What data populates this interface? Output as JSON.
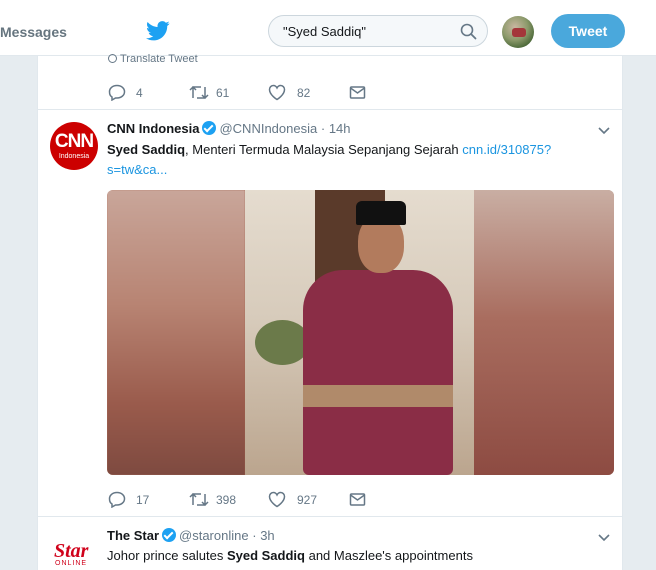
{
  "nav": {
    "messages_label": "Messages",
    "search_value": "\"Syed Saddiq\"",
    "tweet_button": "Tweet"
  },
  "previous_tweet": {
    "translate_label": "Translate Tweet",
    "replies": "4",
    "retweets": "61",
    "likes": "82"
  },
  "tweets": [
    {
      "name": "CNN Indonesia",
      "handle": "@CNNIndonesia",
      "separator": "·",
      "time": "14h",
      "logo_text": "CNN",
      "logo_subtext": "Indonesia",
      "text_bold": "Syed Saddiq",
      "text_rest": ", Menteri Termuda Malaysia Sepanjang Sejarah ",
      "link_line1": "cnn.id/310875?",
      "link_line2": "s=tw&ca...",
      "replies": "17",
      "retweets": "398",
      "likes": "927"
    },
    {
      "name": "The Star",
      "handle": "@staronline",
      "separator": "·",
      "time": "3h",
      "logo_text": "Star",
      "logo_subtext": "ONLINE",
      "text_pre": "Johor prince salutes ",
      "text_bold": "Syed Saddiq",
      "text_post": " and Maszlee's appointments"
    }
  ],
  "colors": {
    "accent": "#1da1f2",
    "tweet_button": "#4aa8dc",
    "link": "#1b95e0",
    "cnn_red": "#cc0000",
    "star_red": "#d0021b"
  }
}
